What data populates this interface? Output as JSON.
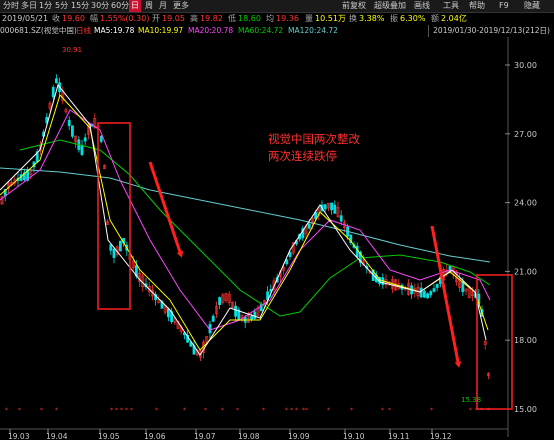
{
  "toolbar": {
    "left_items": [
      "分时",
      "多日",
      "1分",
      "5分",
      "15分",
      "30分",
      "60分",
      "日",
      "周",
      "月",
      "更多"
    ],
    "active": "日",
    "right_items": [
      "前复权",
      "超级叠加",
      "画线",
      "工具",
      "帮助",
      "F9",
      "隐藏"
    ]
  },
  "quote": {
    "date": "2019/05/21",
    "close_label": "收",
    "close_value": "19.60",
    "change_label": "幅",
    "change_value": "1.55%(0.30)",
    "open_label": "开",
    "open_value": "19.05",
    "high_label": "高",
    "high_value": "19.82",
    "low_label": "低",
    "low_value": "18.60",
    "avg_label": "均",
    "avg_value": "19.36",
    "volume_label": "量",
    "volume_value": "10.51万",
    "turnover_label": "换",
    "turnover_value": "3.38%",
    "amplitude_label": "振",
    "amplitude_value": "6.30%",
    "amount_label": "额",
    "amount_value": "2.04亿"
  },
  "ma_bar": {
    "code": "000681.SZ(视觉中国)",
    "period": "日线",
    "ma5": "MA5:19.78",
    "ma10": "MA10:19.97",
    "ma20": "MA20:20.78",
    "ma60": "MA60:24.72",
    "ma120": "MA120:24.72",
    "date_range": "2019/01/30-2019/12/13(212日)"
  },
  "chart_data": {
    "type": "candlestick",
    "y_ticks": [
      "30.00",
      "27.00",
      "24.00",
      "21.00",
      "18.00",
      "15.00"
    ],
    "ylim": [
      14.8,
      31.4
    ],
    "x_ticks": [
      "19.03",
      "19.04",
      "19.05",
      "19.06",
      "19.07",
      "19.08",
      "19.09",
      "19.10",
      "19.11",
      "19.12"
    ],
    "annotation": [
      "视觉中国两次整改",
      "两次连续跌停"
    ],
    "high_label": "30.91",
    "low_label": "15.38",
    "colors": {
      "up": "#ff3232",
      "down": "#00e0e0",
      "ma5": "#ffffff",
      "ma10": "#ffff00",
      "ma20": "#ff44ff",
      "ma60": "#00cc00",
      "ma120": "#66cccc",
      "annotation": "#ff3030"
    }
  }
}
